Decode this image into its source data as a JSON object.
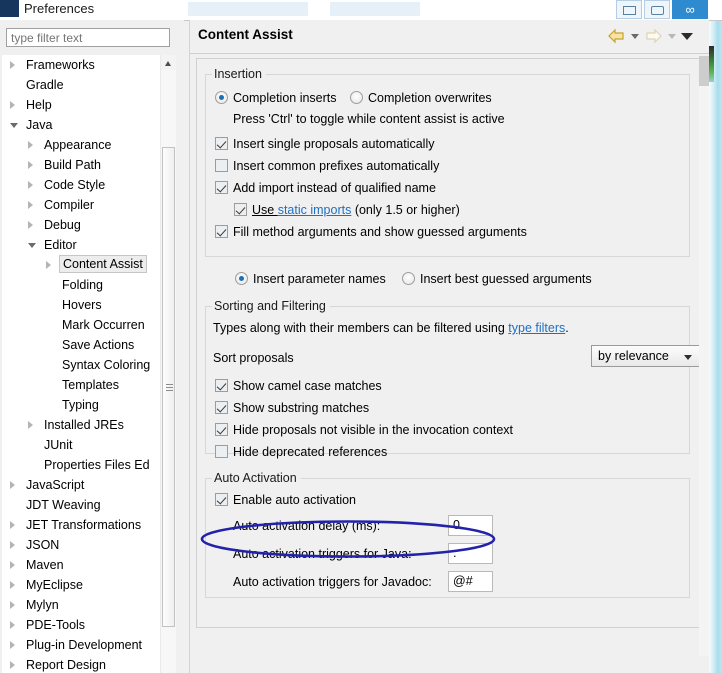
{
  "window": {
    "title": "Preferences",
    "icon": "app-icon",
    "buttons": [
      {
        "name": "minimize-button",
        "glyph": "—"
      },
      {
        "name": "restore-button",
        "glyph": "□"
      },
      {
        "name": "infinity-button",
        "glyph": "∞"
      }
    ]
  },
  "sidebar": {
    "filter": {
      "placeholder": "type filter text",
      "value": ""
    },
    "items": [
      {
        "label": "Frameworks",
        "indent": 0,
        "state": "closed",
        "selected": false
      },
      {
        "label": "Gradle",
        "indent": 0,
        "state": "leaf",
        "selected": false
      },
      {
        "label": "Help",
        "indent": 0,
        "state": "closed",
        "selected": false
      },
      {
        "label": "Java",
        "indent": 0,
        "state": "open",
        "selected": false
      },
      {
        "label": "Appearance",
        "indent": 1,
        "state": "closed",
        "selected": false
      },
      {
        "label": "Build Path",
        "indent": 1,
        "state": "closed",
        "selected": false
      },
      {
        "label": "Code Style",
        "indent": 1,
        "state": "closed",
        "selected": false
      },
      {
        "label": "Compiler",
        "indent": 1,
        "state": "closed",
        "selected": false
      },
      {
        "label": "Debug",
        "indent": 1,
        "state": "closed",
        "selected": false
      },
      {
        "label": "Editor",
        "indent": 1,
        "state": "open",
        "selected": false
      },
      {
        "label": "Content Assist",
        "indent": 2,
        "state": "closed",
        "selected": true
      },
      {
        "label": "Folding",
        "indent": 2,
        "state": "leaf",
        "selected": false
      },
      {
        "label": "Hovers",
        "indent": 2,
        "state": "leaf",
        "selected": false
      },
      {
        "label": "Mark Occurren",
        "indent": 2,
        "state": "leaf",
        "selected": false
      },
      {
        "label": "Save Actions",
        "indent": 2,
        "state": "leaf",
        "selected": false
      },
      {
        "label": "Syntax Coloring",
        "indent": 2,
        "state": "leaf",
        "selected": false
      },
      {
        "label": "Templates",
        "indent": 2,
        "state": "leaf",
        "selected": false
      },
      {
        "label": "Typing",
        "indent": 2,
        "state": "leaf",
        "selected": false
      },
      {
        "label": "Installed JREs",
        "indent": 1,
        "state": "closed",
        "selected": false
      },
      {
        "label": "JUnit",
        "indent": 1,
        "state": "leaf",
        "selected": false
      },
      {
        "label": "Properties Files Ed",
        "indent": 1,
        "state": "leaf",
        "selected": false
      },
      {
        "label": "JavaScript",
        "indent": 0,
        "state": "closed",
        "selected": false
      },
      {
        "label": "JDT Weaving",
        "indent": 0,
        "state": "leaf",
        "selected": false
      },
      {
        "label": "JET Transformations",
        "indent": 0,
        "state": "closed",
        "selected": false
      },
      {
        "label": "JSON",
        "indent": 0,
        "state": "closed",
        "selected": false
      },
      {
        "label": "Maven",
        "indent": 0,
        "state": "closed",
        "selected": false
      },
      {
        "label": "MyEclipse",
        "indent": 0,
        "state": "closed",
        "selected": false
      },
      {
        "label": "Mylyn",
        "indent": 0,
        "state": "closed",
        "selected": false
      },
      {
        "label": "PDE-Tools",
        "indent": 0,
        "state": "closed",
        "selected": false
      },
      {
        "label": "Plug-in Development",
        "indent": 0,
        "state": "closed",
        "selected": false
      },
      {
        "label": "Report Design",
        "indent": 0,
        "state": "closed",
        "selected": false
      }
    ]
  },
  "page": {
    "title": "Content Assist",
    "nav": {
      "back_icon": "back-arrow-icon",
      "back_menu_icon": "chevron-down-icon",
      "forward_icon": "forward-arrow-icon",
      "forward_menu_icon": "chevron-down-icon",
      "menu_icon": "chevron-down-icon"
    },
    "insertion": {
      "legend": "Insertion",
      "radio_inserts": "Completion inserts",
      "radio_overwrites": "Completion overwrites",
      "hint": "Press 'Ctrl' to toggle while content assist is active",
      "chk_single_proposals": "Insert single proposals automatically",
      "chk_common_prefixes": "Insert common prefixes automatically",
      "chk_add_import": "Add import instead of qualified name",
      "chk_static_pre": "Use ",
      "chk_static_link": "static imports",
      "chk_static_post": " (only 1.5 or higher)",
      "chk_fill_method": "Fill method arguments and show guessed arguments",
      "radio_param_names": "Insert parameter names",
      "radio_best_guessed": "Insert best guessed arguments"
    },
    "sorting": {
      "legend": "Sorting and Filtering",
      "desc_pre": "Types along with their members can be filtered using ",
      "desc_link": "type filters",
      "desc_post": ".",
      "sort_label": "Sort proposals",
      "sort_value": "by relevance",
      "chk_camel_case": "Show camel case matches",
      "chk_substring": "Show substring matches",
      "chk_hide_not_visible": "Hide proposals not visible in the invocation context",
      "chk_hide_deprecated": "Hide deprecated references"
    },
    "auto_activation": {
      "legend": "Auto Activation",
      "chk_enable": "Enable auto activation",
      "delay_label": "Auto activation delay (ms):",
      "delay_value": "0",
      "java_label": "Auto activation triggers for Java:",
      "java_value": ".",
      "javadoc_label": "Auto activation triggers for Javadoc:",
      "javadoc_value": "@#"
    }
  },
  "annotation": {
    "shape": "ellipse",
    "color": "#2222aa",
    "target": "Auto activation triggers for Java row"
  }
}
